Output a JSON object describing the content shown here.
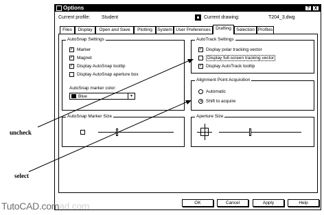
{
  "dialog": {
    "title": "Options",
    "help_button": "?",
    "close_button": "X",
    "current_profile_label": "Current profile:",
    "current_profile_value": "Student",
    "current_drawing_label": "Current drawing:",
    "current_drawing_value": "T204_3.dwg"
  },
  "tabs": [
    {
      "label": "Files",
      "active": false
    },
    {
      "label": "Display",
      "active": false
    },
    {
      "label": "Open and Save",
      "active": false
    },
    {
      "label": "Plotting",
      "active": false
    },
    {
      "label": "System",
      "active": false
    },
    {
      "label": "User Preferences",
      "active": false
    },
    {
      "label": "Drafting",
      "active": true
    },
    {
      "label": "Selection",
      "active": false
    },
    {
      "label": "Profiles",
      "active": false
    }
  ],
  "autosnap": {
    "title": "AutoSnap Settings",
    "options": [
      {
        "label": "Marker",
        "checked": true
      },
      {
        "label": "Magnet",
        "checked": true
      },
      {
        "label": "Display AutoSnap tooltip",
        "checked": true
      },
      {
        "label": "Display AutoSnap aperture box",
        "checked": false
      }
    ],
    "marker_color_label": "AutoSnap marker color:",
    "marker_color_value": "Blue"
  },
  "autotrack": {
    "title": "AutoTrack Settings",
    "options": [
      {
        "label": "Display polar tracking vector",
        "checked": true
      },
      {
        "label": "Display full-screen tracking vector",
        "checked": false
      },
      {
        "label": "Display AutoTrack tooltip",
        "checked": true
      }
    ]
  },
  "alignment": {
    "title": "Alignment Point Acquisition",
    "options": [
      {
        "label": "Automatic",
        "selected": false
      },
      {
        "label": "Shift to acquire",
        "selected": true
      }
    ]
  },
  "marker_size": {
    "title": "AutoSnap Marker Size"
  },
  "aperture_size": {
    "title": "Aperture Size"
  },
  "buttons": {
    "ok": "OK",
    "cancel": "Cancel",
    "apply": "Apply",
    "help": "Help"
  },
  "annotations": {
    "uncheck": "uncheck",
    "select": "select"
  },
  "watermark": {
    "main": "TutoCAD.com",
    "faint": "ad.com"
  },
  "icons": [
    "dialog-icon",
    "drawing-icon",
    "help-icon",
    "close-icon",
    "dropdown-arrow-icon",
    "crosshair-icon"
  ]
}
